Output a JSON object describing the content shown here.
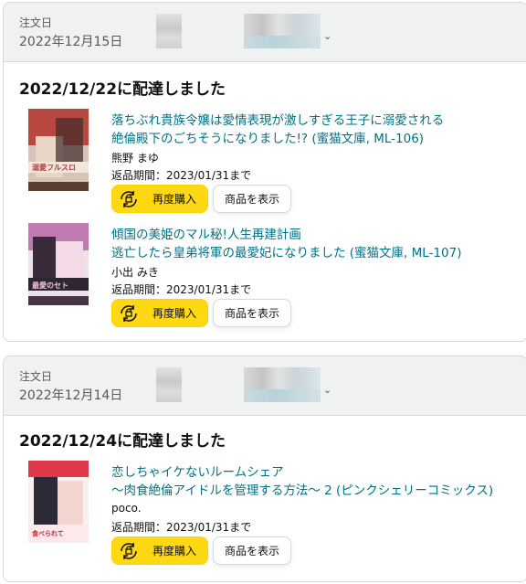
{
  "orders": [
    {
      "header": {
        "label": "注文日",
        "date": "2022年12月15日"
      },
      "delivery": "2022/12/22に配達しました",
      "items": [
        {
          "title_line1": "落ちぶれ貴族令嬢は愛情表現が激しすぎる王子に溺愛される",
          "title_line2": "絶倫殿下のごちそうになりました!? (蜜猫文庫, ML-106)",
          "author": "熊野 まゆ",
          "return": "返品期間：2023/01/31まで",
          "buy_again": "再度購入",
          "view": "商品を表示"
        },
        {
          "title_line1": "傾国の美姫のマル秘!人生再建計画",
          "title_line2": "逃亡したら皇弟将軍の最愛妃になりました (蜜猫文庫, ML-107)",
          "author": "小出 みき",
          "return": "返品期間：2023/01/31まで",
          "buy_again": "再度購入",
          "view": "商品を表示"
        }
      ]
    },
    {
      "header": {
        "label": "注文日",
        "date": "2022年12月14日"
      },
      "delivery": "2022/12/24に配達しました",
      "items": [
        {
          "title_line1": "恋しちゃイケないルームシェア",
          "title_line2": "～肉食絶倫アイドルを管理する方法～ 2 (ピンクシェリーコミックス)",
          "author": "poco.",
          "return": "返品期間：2023/01/31まで",
          "buy_again": "再度購入",
          "view": "商品を表示"
        }
      ]
    }
  ],
  "icons": {
    "buy_again": "repeat-cart-icon",
    "dropdown": "chevron-down-icon"
  }
}
